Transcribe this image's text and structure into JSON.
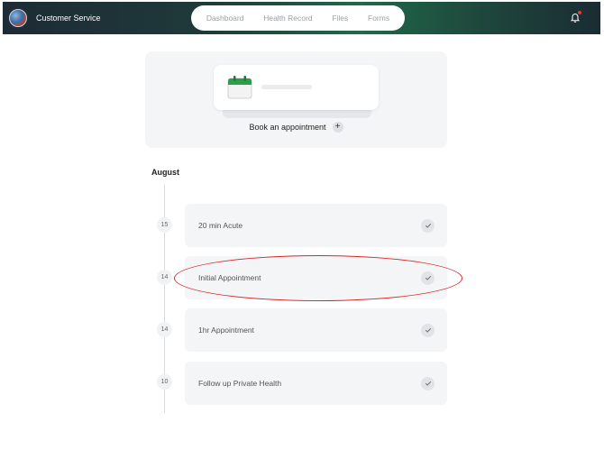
{
  "header": {
    "brand_name": "Customer Service",
    "nav": [
      "Dashboard",
      "Health Record",
      "Files",
      "Forms"
    ],
    "notification_badge_color": "#e53935"
  },
  "book": {
    "label": "Book an appointment",
    "plus": "+"
  },
  "timeline": {
    "month": "August",
    "appointments": [
      {
        "day": "15",
        "title": "20 min Acute",
        "status": "check-icon"
      },
      {
        "day": "14",
        "title": "Initial Appointment",
        "status": "check-icon",
        "highlighted": true
      },
      {
        "day": "14",
        "title": "1hr Appointment",
        "status": "check-icon"
      },
      {
        "day": "10",
        "title": "Follow up Private Health",
        "status": "check-icon"
      }
    ]
  },
  "colors": {
    "highlight": "#d42a2a",
    "calendar_green": "#2e9d4a"
  }
}
